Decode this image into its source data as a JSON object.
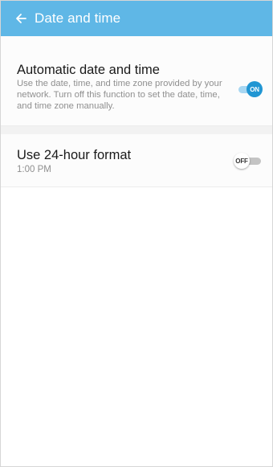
{
  "app_bar": {
    "title": "Date and time",
    "back_icon": "arrow-left-icon",
    "color": "#5fb7e6"
  },
  "settings": [
    {
      "title": "Automatic date and time",
      "description": "Use the date, time, and time zone provided by your network. Turn off this function to set the date, time, and time zone manually.",
      "toggle_state": "ON"
    },
    {
      "title": "Use 24-hour format",
      "subtitle": "1:00 PM",
      "toggle_state": "OFF"
    }
  ],
  "colors": {
    "toggle_on": "#2196d3",
    "toggle_off_track": "#c4c4c4"
  }
}
